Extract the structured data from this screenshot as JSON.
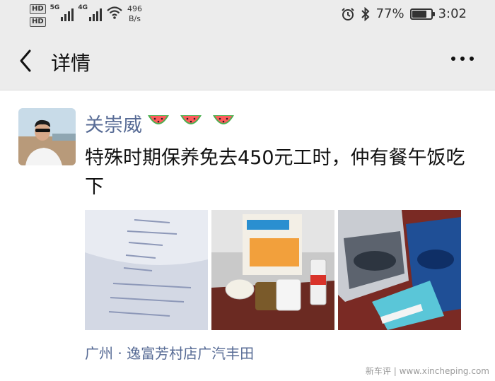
{
  "status_bar": {
    "hd1": "HD",
    "hd2": "HD",
    "sim1_label": "5G",
    "sim2_label": "4G",
    "net_speed_value": "496",
    "net_speed_unit": "B/s",
    "battery_percent_text": "77%",
    "battery_level": 0.77,
    "time": "3:02",
    "icons": [
      "alarm-icon",
      "bluetooth-icon",
      "battery-icon",
      "wifi-icon",
      "signal-icon"
    ]
  },
  "nav": {
    "title": "详情",
    "back_icon": "chevron-left-icon",
    "more_icon": "more-dots-icon"
  },
  "post": {
    "username": "关崇威",
    "username_emojis": [
      "watermelon",
      "watermelon",
      "watermelon"
    ],
    "text": "特殊时期保养免去450元工时，仲有餐午饭吃下",
    "photos": [
      "document-photo",
      "lunch-tray-photo",
      "brochure-photo"
    ],
    "location": "广州 · 逸富芳村店广汽丰田"
  },
  "watermark": "新车评 | www.xincheping.com",
  "colors": {
    "link": "#576b95",
    "bar_bg": "#ececec",
    "text": "#111111"
  }
}
